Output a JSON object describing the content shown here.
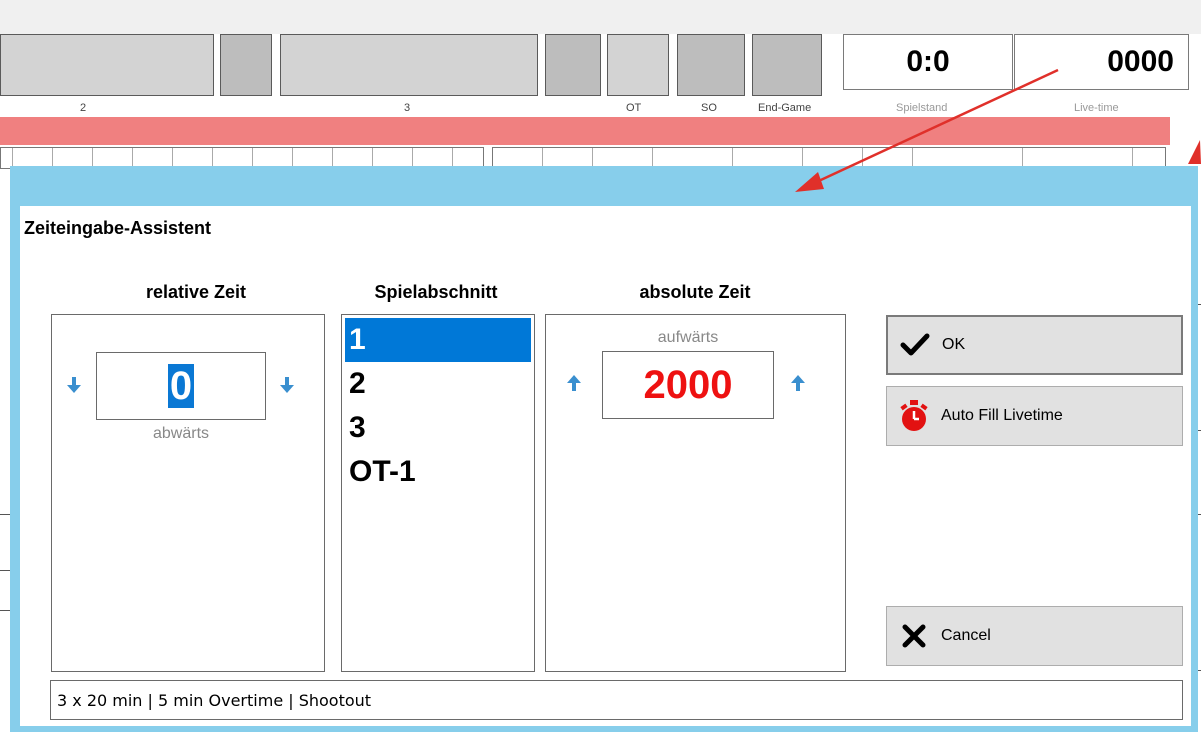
{
  "scoreboard": {
    "period_labels": [
      "2",
      "3",
      "OT",
      "SO",
      "End-Game"
    ],
    "score_value": "0:0",
    "score_label": "Spielstand",
    "livetime_value": "0000",
    "livetime_label": "Live-time"
  },
  "dialog": {
    "title": "Zeiteingabe-Assistent",
    "relative": {
      "heading": "relative Zeit",
      "value": "0",
      "direction_hint": "abwärts"
    },
    "period": {
      "heading": "Spielabschnitt",
      "items": [
        "1",
        "2",
        "3",
        "OT-1"
      ],
      "selected": "1"
    },
    "absolute": {
      "heading": "absolute Zeit",
      "direction_hint": "aufwärts",
      "value": "2000"
    },
    "buttons": {
      "ok_label": "OK",
      "autofill_label": "Auto Fill Livetime",
      "cancel_label": "Cancel"
    },
    "rules_text": "3 x 20 min | 5 min Overtime | Shootout"
  },
  "colors": {
    "dialog_frame": "#87ceeb",
    "red_bar": "#f08080",
    "annotation_arrow": "#e0302a",
    "selection": "#0078d7",
    "absolute_time": "#ee1111",
    "arrow_icons": "#3a8fcf"
  },
  "icons": {
    "relative_left": "arrow-down-icon",
    "relative_right": "arrow-down-icon",
    "absolute_left": "arrow-up-icon",
    "absolute_right": "arrow-up-icon",
    "ok": "checkmark-icon",
    "autofill": "stopwatch-icon",
    "cancel": "x-mark-icon"
  }
}
